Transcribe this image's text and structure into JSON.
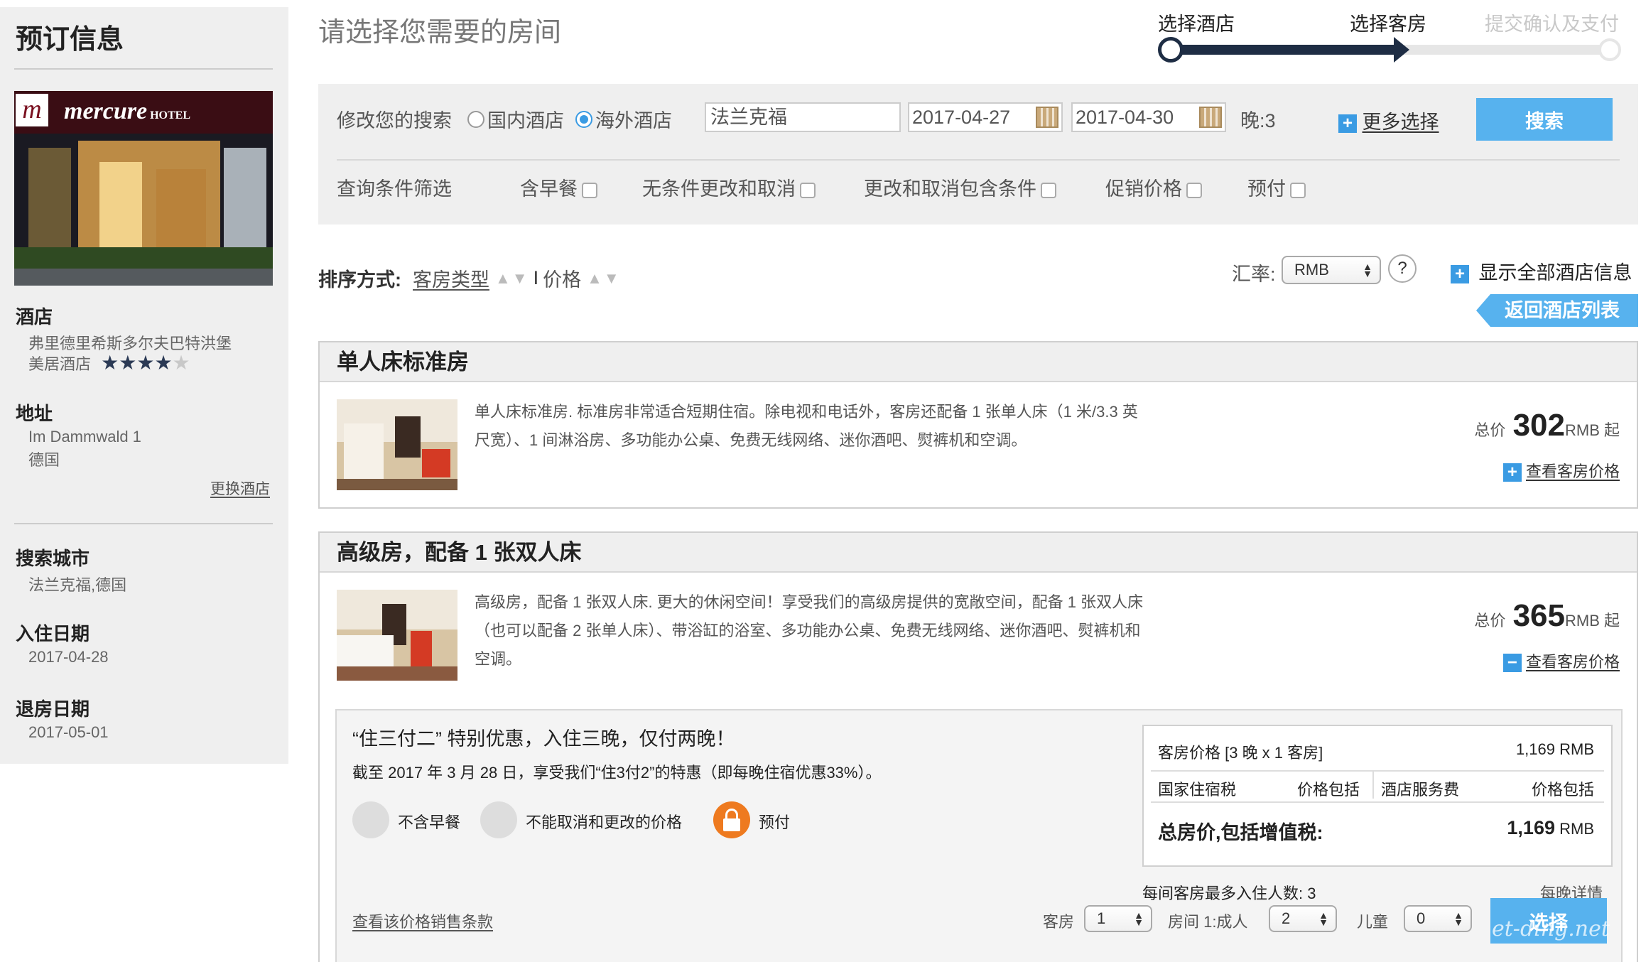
{
  "sidebar": {
    "title": "预订信息",
    "hotel_label": "酒店",
    "hotel_name_line1": "弗里德里希斯多尔夫巴特洪堡",
    "hotel_name_line2": "美居酒店",
    "stars": "★★★★",
    "star_empty": "★",
    "address_label": "地址",
    "address_line1": "Im Dammwald 1",
    "address_line2": "德国",
    "change_hotel": "更换酒店",
    "city_label": "搜索城市",
    "city_value": "法兰克福,德国",
    "checkin_label": "入住日期",
    "checkin_value": "2017-04-28",
    "checkout_label": "退房日期",
    "checkout_value": "2017-05-01",
    "logo_text": "mercure",
    "logo_sub": "HOTEL",
    "logo_m": "m"
  },
  "header": {
    "title": "请选择您需要的房间",
    "steps": [
      "选择酒店",
      "选择客房",
      "提交确认及支付"
    ]
  },
  "search": {
    "modify_label": "修改您的搜索",
    "radio_domestic": "国内酒店",
    "radio_overseas": "海外酒店",
    "city": "法兰克福",
    "date_in": "2017-04-27",
    "date_out": "2017-04-30",
    "nights": "晚:3",
    "more_options": "更多选择",
    "search_button": "搜索",
    "filter_label": "查询条件筛选",
    "filters": [
      "含早餐",
      "无条件更改和取消",
      "更改和取消包含条件",
      "促销价格",
      "预付"
    ]
  },
  "sort": {
    "label": "排序方式:",
    "by_type": "客房类型",
    "sep": "I",
    "by_price": "价格",
    "currency_label": "汇率:",
    "currency_value": "RMB",
    "help": "?",
    "show_all": "显示全部酒店信息",
    "back_to_list": "返回酒店列表"
  },
  "rooms": [
    {
      "title": "单人床标准房",
      "desc_line1": "单人床标准房. 标准房非常适合短期住宿。除电视和电话外，客房还配备 1 张单人床（1 米/3.3 英",
      "desc_line2": "尺宽）、1 间淋浴房、多功能办公桌、免费无线网络、迷你酒吧、熨裤机和空调。",
      "price_prefix": "总价",
      "price": "302",
      "price_suffix": "RMB 起",
      "view_prices": "查看客房价格"
    },
    {
      "title": "高级房，配备 1 张双人床",
      "desc_line1": "高级房，配备 1 张双人床. 更大的休闲空间！享受我们的高级房提供的宽敞空间，配备 1 张双人床",
      "desc_line2": "（也可以配备 2 张单人床）、带浴缸的浴室、多功能办公桌、免费无线网络、迷你酒吧、熨裤机和",
      "desc_line3": "空调。",
      "price_prefix": "总价",
      "price": "365",
      "price_suffix": "RMB 起",
      "view_prices": "查看客房价格"
    }
  ],
  "offer": {
    "title": "“住三付二” 特别优惠，入住三晚，仅付两晚！",
    "desc": "截至 2017 年 3 月 28 日，享受我们“住3付2”的特惠（即每晚住宿优惠33%）。",
    "features": [
      "不含早餐",
      "不能取消和更改的价格",
      "预付"
    ],
    "terms_link": "查看该价格销售条款",
    "price_table": {
      "room_price_label": "客房价格 [3 晚 x 1 客房]",
      "room_price_value": "1,169 RMB",
      "tax_label": "国家住宿税",
      "tax_value": "价格包括",
      "service_label": "酒店服务费",
      "service_value": "价格包括",
      "total_label": "总房价,包括增值税:",
      "total_value": "1,169",
      "total_unit": "RMB"
    },
    "max_guests": "每间客房最多入住人数: 3",
    "nightly_details": "每晚详情",
    "rooms_label": "客房",
    "rooms_value": "1",
    "adults_label": "房间 1:成人",
    "adults_value": "2",
    "children_label": "儿童",
    "children_value": "0",
    "select_button": "选择"
  },
  "watermark": "et-ding.net",
  "colors": {
    "accent_blue": "#57b2ee",
    "progress_dark": "#1e2d44",
    "promo_orange": "#ee7a1f"
  }
}
